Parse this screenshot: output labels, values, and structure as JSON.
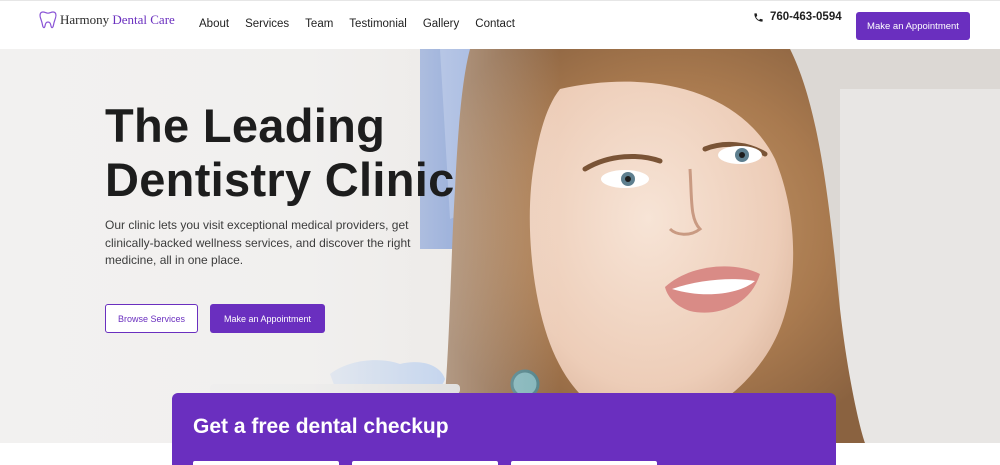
{
  "brand": {
    "name_part1": "Harmony ",
    "name_part2": "Dental Care",
    "accent_color": "#6a2fbf",
    "icon": "tooth-icon"
  },
  "nav": {
    "items": [
      "About",
      "Services",
      "Team",
      "Testimonial",
      "Gallery",
      "Contact"
    ],
    "phone": "760-463-0594",
    "phone_icon": "phone-icon",
    "cta_label": "Make an Appointment"
  },
  "hero": {
    "title_line1": "The Leading",
    "title_line2": "Dentistry Clinic",
    "description": "Our clinic lets you visit exceptional medical providers, get clinically-backed wellness services, and discover the right medicine, all in one place.",
    "browse_label": "Browse Services",
    "appointment_label": "Make an Appointment"
  },
  "checkup": {
    "title": "Get a free dental checkup"
  }
}
